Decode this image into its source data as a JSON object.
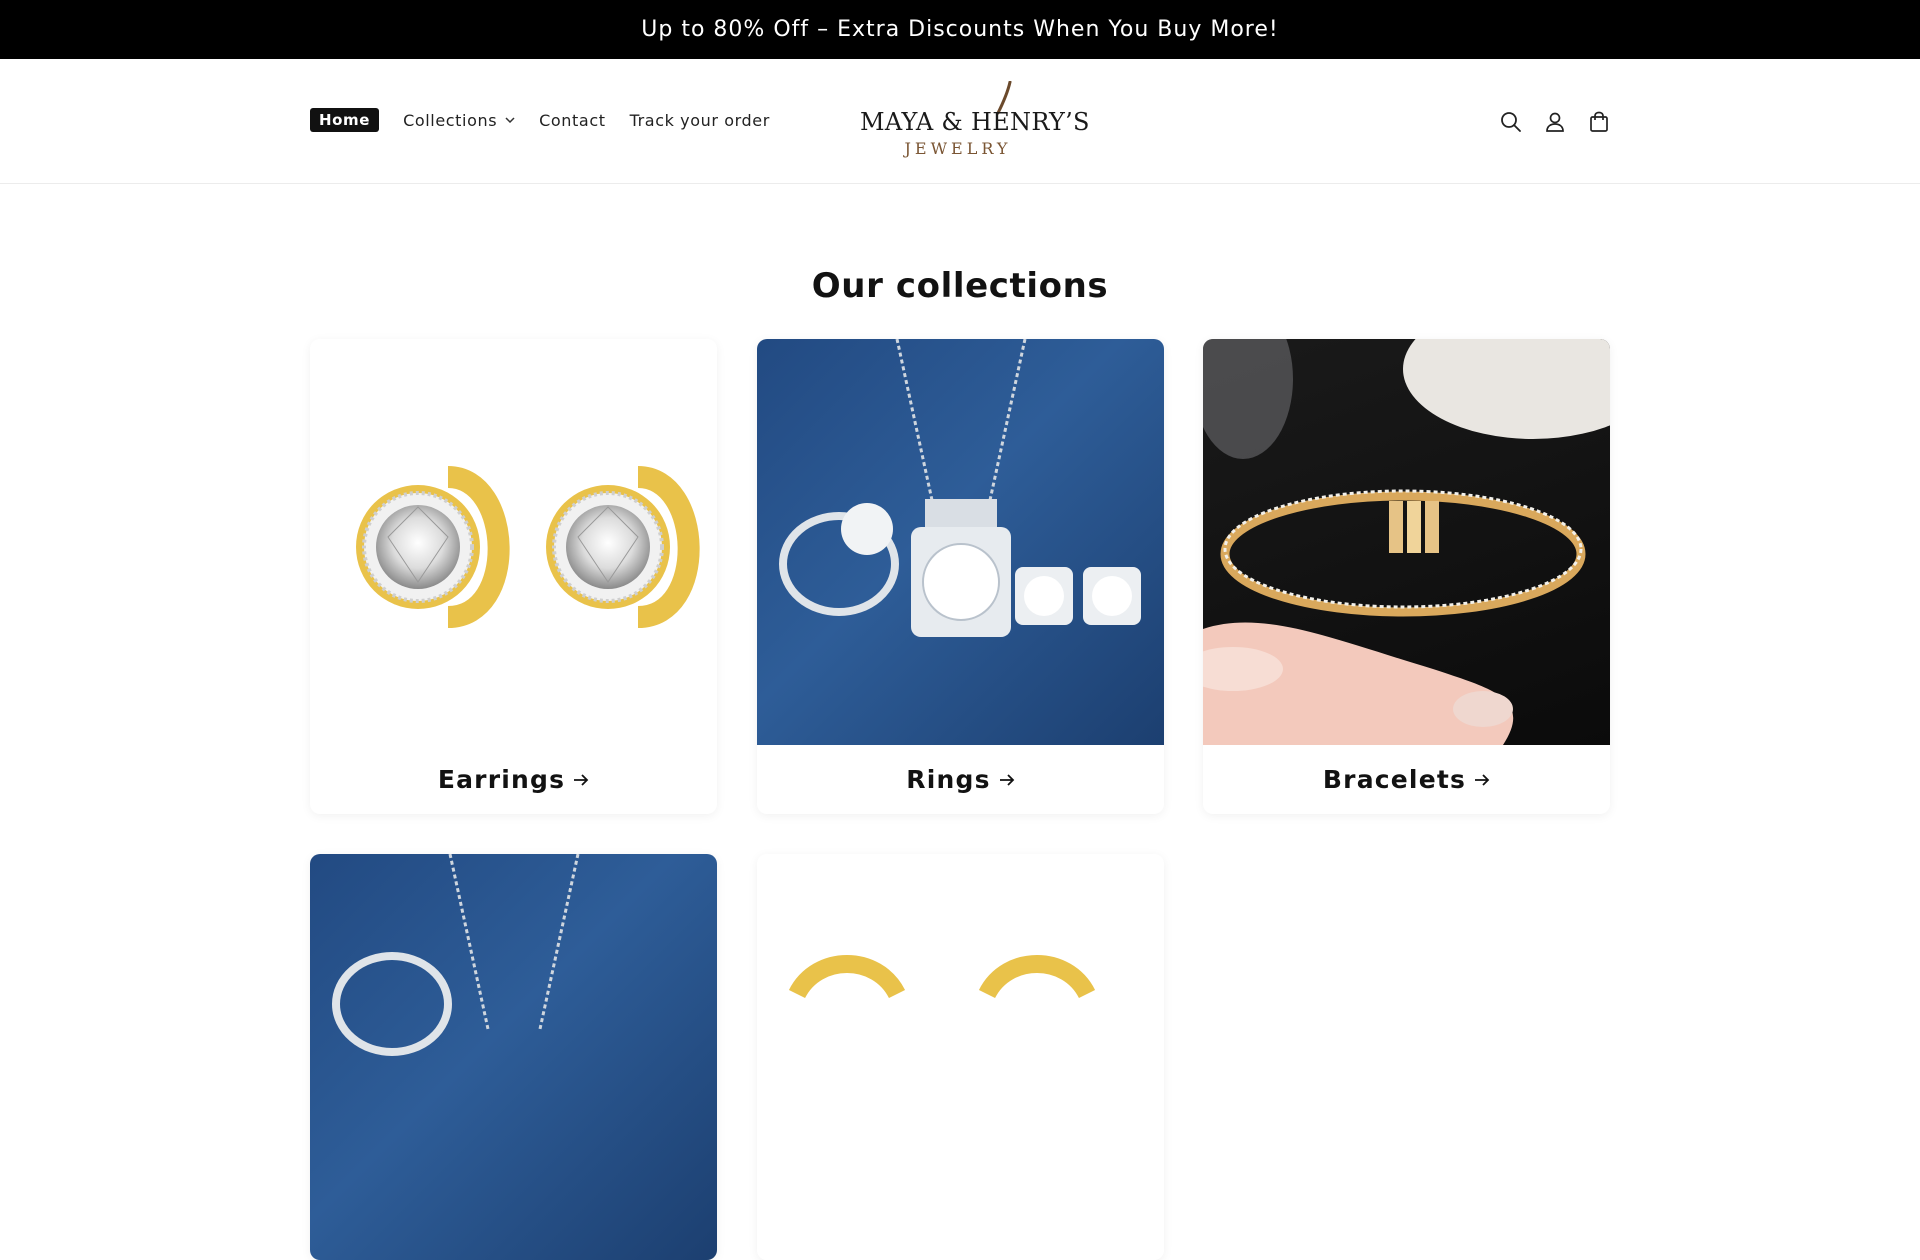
{
  "announcement": {
    "text": "Up to 80% Off – Extra Discounts When You Buy More!"
  },
  "nav": {
    "items": [
      {
        "label": "Home",
        "active": true
      },
      {
        "label": "Collections",
        "has_dropdown": true
      },
      {
        "label": "Contact"
      },
      {
        "label": "Track your order"
      }
    ]
  },
  "logo": {
    "line1": "MAYA & HENRY’S",
    "line2": "JEWELRY"
  },
  "header_icons": [
    "search-icon",
    "account-icon",
    "cart-icon"
  ],
  "main": {
    "title": "Our collections",
    "collections": [
      {
        "label": "Earrings"
      },
      {
        "label": "Rings"
      },
      {
        "label": "Bracelets"
      },
      {
        "label": ""
      },
      {
        "label": ""
      }
    ]
  },
  "colors": {
    "announcement_bg": "#000000",
    "gold": "#e9c24a",
    "blue_bg": "#2a5591",
    "logo_brown": "#7a5533"
  }
}
